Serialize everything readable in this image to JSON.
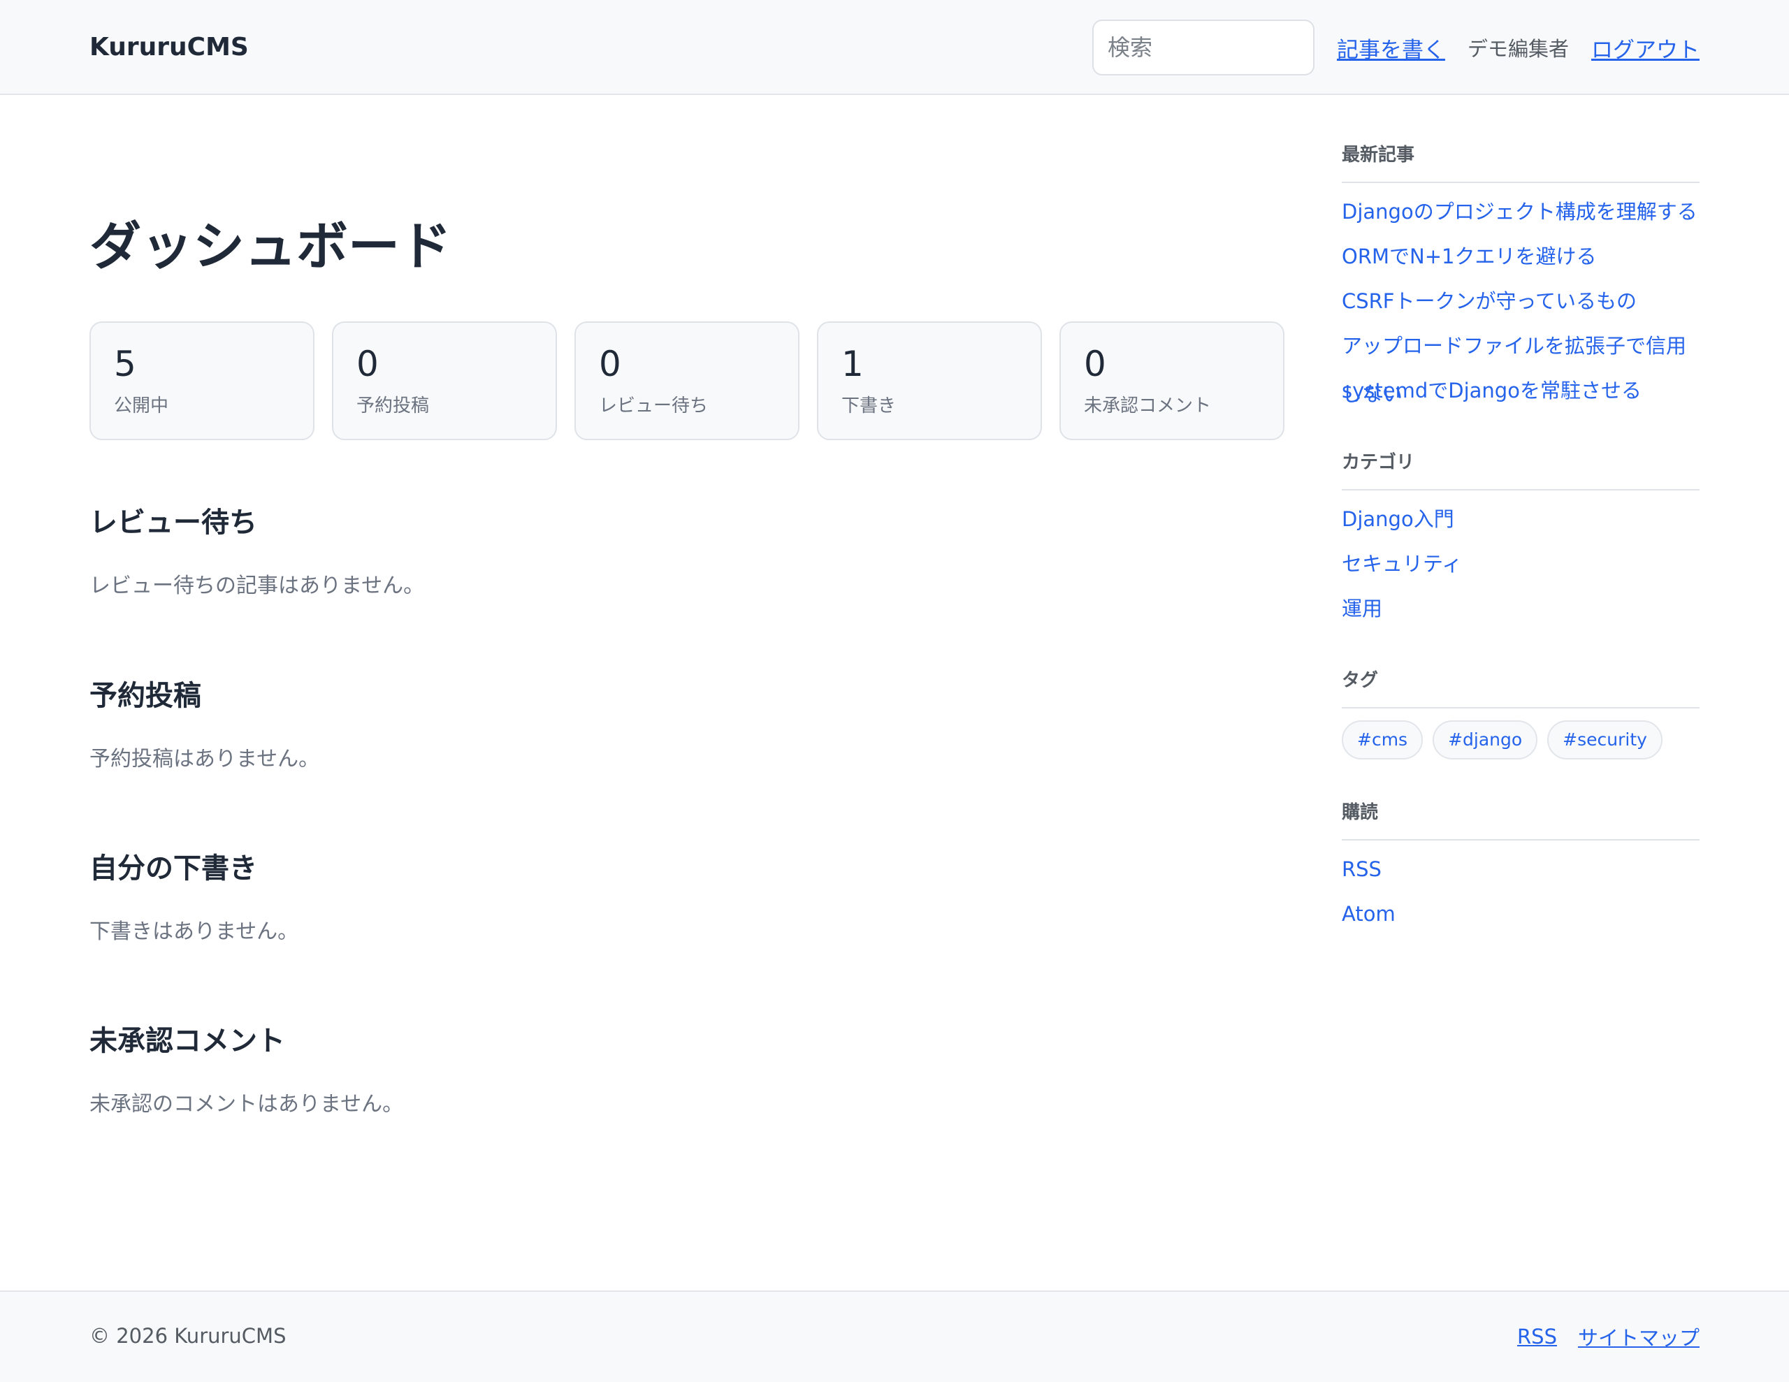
{
  "header": {
    "brand": "KururuCMS",
    "search_placeholder": "検索",
    "write_link": "記事を書く",
    "user_name": "デモ編集者",
    "logout_link": "ログアウト"
  },
  "main": {
    "title": "ダッシュボード",
    "stats": [
      {
        "value": "5",
        "label": "公開中"
      },
      {
        "value": "0",
        "label": "予約投稿"
      },
      {
        "value": "0",
        "label": "レビュー待ち"
      },
      {
        "value": "1",
        "label": "下書き"
      },
      {
        "value": "0",
        "label": "未承認コメント"
      }
    ],
    "sections": [
      {
        "title": "レビュー待ち",
        "empty": "レビュー待ちの記事はありません。"
      },
      {
        "title": "予約投稿",
        "empty": "予約投稿はありません。"
      },
      {
        "title": "自分の下書き",
        "empty": "下書きはありません。"
      },
      {
        "title": "未承認コメント",
        "empty": "未承認のコメントはありません。"
      }
    ]
  },
  "sidebar": {
    "recent": {
      "heading": "最新記事",
      "items": [
        "Djangoのプロジェクト構成を理解する",
        "ORMでN+1クエリを避ける",
        "CSRFトークンが守っているもの",
        "アップロードファイルを拡張子で信用しない",
        "systemdでDjangoを常駐させる"
      ]
    },
    "categories": {
      "heading": "カテゴリ",
      "items": [
        "Django入門",
        "セキュリティ",
        "運用"
      ]
    },
    "tags": {
      "heading": "タグ",
      "items": [
        "#cms",
        "#django",
        "#security"
      ]
    },
    "subscribe": {
      "heading": "購読",
      "items": [
        "RSS",
        "Atom"
      ]
    }
  },
  "footer": {
    "copyright": "© 2026 KururuCMS",
    "links": [
      "RSS",
      "サイトマップ"
    ]
  },
  "colors": {
    "link": "#2563eb",
    "text": "#1f2937",
    "muted": "#6b7280",
    "surface": "#f8f9fa",
    "border": "#dfe3e8"
  }
}
